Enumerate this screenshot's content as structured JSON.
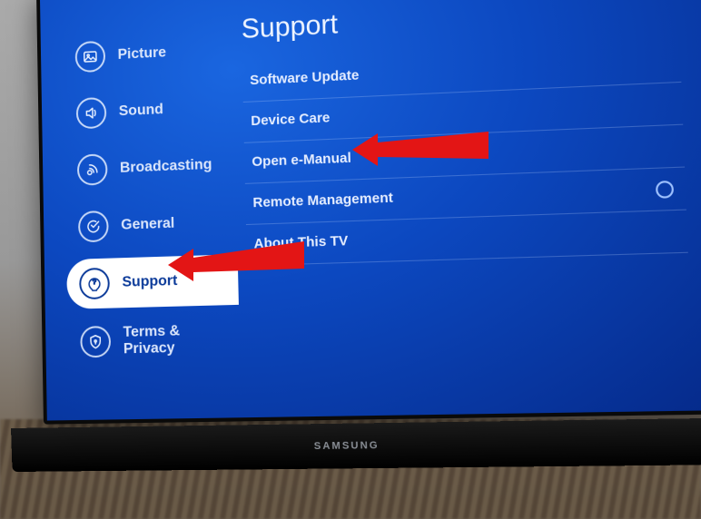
{
  "sidebar": {
    "items": [
      {
        "label": "Picture",
        "icon": "picture"
      },
      {
        "label": "Sound",
        "icon": "sound"
      },
      {
        "label": "Broadcasting",
        "icon": "broadcasting"
      },
      {
        "label": "General",
        "icon": "general"
      },
      {
        "label": "Support",
        "icon": "support",
        "selected": true
      },
      {
        "label": "Terms & Privacy",
        "icon": "privacy"
      }
    ]
  },
  "page": {
    "title": "Support",
    "options": [
      {
        "label": "Software Update"
      },
      {
        "label": "Device Care",
        "highlighted": true
      },
      {
        "label": "Open e-Manual"
      },
      {
        "label": "Remote Management",
        "has_toggle": true
      },
      {
        "label": "About This TV"
      }
    ]
  },
  "brand": "SAMSUNG"
}
